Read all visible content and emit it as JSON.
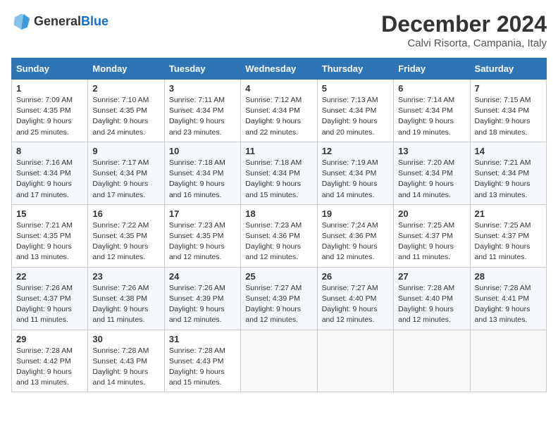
{
  "logo": {
    "text_general": "General",
    "text_blue": "Blue"
  },
  "header": {
    "month": "December 2024",
    "location": "Calvi Risorta, Campania, Italy"
  },
  "weekdays": [
    "Sunday",
    "Monday",
    "Tuesday",
    "Wednesday",
    "Thursday",
    "Friday",
    "Saturday"
  ],
  "weeks": [
    [
      {
        "day": "1",
        "info": "Sunrise: 7:09 AM\nSunset: 4:35 PM\nDaylight: 9 hours\nand 25 minutes."
      },
      {
        "day": "2",
        "info": "Sunrise: 7:10 AM\nSunset: 4:35 PM\nDaylight: 9 hours\nand 24 minutes."
      },
      {
        "day": "3",
        "info": "Sunrise: 7:11 AM\nSunset: 4:34 PM\nDaylight: 9 hours\nand 23 minutes."
      },
      {
        "day": "4",
        "info": "Sunrise: 7:12 AM\nSunset: 4:34 PM\nDaylight: 9 hours\nand 22 minutes."
      },
      {
        "day": "5",
        "info": "Sunrise: 7:13 AM\nSunset: 4:34 PM\nDaylight: 9 hours\nand 20 minutes."
      },
      {
        "day": "6",
        "info": "Sunrise: 7:14 AM\nSunset: 4:34 PM\nDaylight: 9 hours\nand 19 minutes."
      },
      {
        "day": "7",
        "info": "Sunrise: 7:15 AM\nSunset: 4:34 PM\nDaylight: 9 hours\nand 18 minutes."
      }
    ],
    [
      {
        "day": "8",
        "info": "Sunrise: 7:16 AM\nSunset: 4:34 PM\nDaylight: 9 hours\nand 17 minutes."
      },
      {
        "day": "9",
        "info": "Sunrise: 7:17 AM\nSunset: 4:34 PM\nDaylight: 9 hours\nand 17 minutes."
      },
      {
        "day": "10",
        "info": "Sunrise: 7:18 AM\nSunset: 4:34 PM\nDaylight: 9 hours\nand 16 minutes."
      },
      {
        "day": "11",
        "info": "Sunrise: 7:18 AM\nSunset: 4:34 PM\nDaylight: 9 hours\nand 15 minutes."
      },
      {
        "day": "12",
        "info": "Sunrise: 7:19 AM\nSunset: 4:34 PM\nDaylight: 9 hours\nand 14 minutes."
      },
      {
        "day": "13",
        "info": "Sunrise: 7:20 AM\nSunset: 4:34 PM\nDaylight: 9 hours\nand 14 minutes."
      },
      {
        "day": "14",
        "info": "Sunrise: 7:21 AM\nSunset: 4:34 PM\nDaylight: 9 hours\nand 13 minutes."
      }
    ],
    [
      {
        "day": "15",
        "info": "Sunrise: 7:21 AM\nSunset: 4:35 PM\nDaylight: 9 hours\nand 13 minutes."
      },
      {
        "day": "16",
        "info": "Sunrise: 7:22 AM\nSunset: 4:35 PM\nDaylight: 9 hours\nand 12 minutes."
      },
      {
        "day": "17",
        "info": "Sunrise: 7:23 AM\nSunset: 4:35 PM\nDaylight: 9 hours\nand 12 minutes."
      },
      {
        "day": "18",
        "info": "Sunrise: 7:23 AM\nSunset: 4:36 PM\nDaylight: 9 hours\nand 12 minutes."
      },
      {
        "day": "19",
        "info": "Sunrise: 7:24 AM\nSunset: 4:36 PM\nDaylight: 9 hours\nand 12 minutes."
      },
      {
        "day": "20",
        "info": "Sunrise: 7:25 AM\nSunset: 4:37 PM\nDaylight: 9 hours\nand 11 minutes."
      },
      {
        "day": "21",
        "info": "Sunrise: 7:25 AM\nSunset: 4:37 PM\nDaylight: 9 hours\nand 11 minutes."
      }
    ],
    [
      {
        "day": "22",
        "info": "Sunrise: 7:26 AM\nSunset: 4:37 PM\nDaylight: 9 hours\nand 11 minutes."
      },
      {
        "day": "23",
        "info": "Sunrise: 7:26 AM\nSunset: 4:38 PM\nDaylight: 9 hours\nand 11 minutes."
      },
      {
        "day": "24",
        "info": "Sunrise: 7:26 AM\nSunset: 4:39 PM\nDaylight: 9 hours\nand 12 minutes."
      },
      {
        "day": "25",
        "info": "Sunrise: 7:27 AM\nSunset: 4:39 PM\nDaylight: 9 hours\nand 12 minutes."
      },
      {
        "day": "26",
        "info": "Sunrise: 7:27 AM\nSunset: 4:40 PM\nDaylight: 9 hours\nand 12 minutes."
      },
      {
        "day": "27",
        "info": "Sunrise: 7:28 AM\nSunset: 4:40 PM\nDaylight: 9 hours\nand 12 minutes."
      },
      {
        "day": "28",
        "info": "Sunrise: 7:28 AM\nSunset: 4:41 PM\nDaylight: 9 hours\nand 13 minutes."
      }
    ],
    [
      {
        "day": "29",
        "info": "Sunrise: 7:28 AM\nSunset: 4:42 PM\nDaylight: 9 hours\nand 13 minutes."
      },
      {
        "day": "30",
        "info": "Sunrise: 7:28 AM\nSunset: 4:43 PM\nDaylight: 9 hours\nand 14 minutes."
      },
      {
        "day": "31",
        "info": "Sunrise: 7:28 AM\nSunset: 4:43 PM\nDaylight: 9 hours\nand 15 minutes."
      },
      {
        "day": "",
        "info": ""
      },
      {
        "day": "",
        "info": ""
      },
      {
        "day": "",
        "info": ""
      },
      {
        "day": "",
        "info": ""
      }
    ]
  ]
}
